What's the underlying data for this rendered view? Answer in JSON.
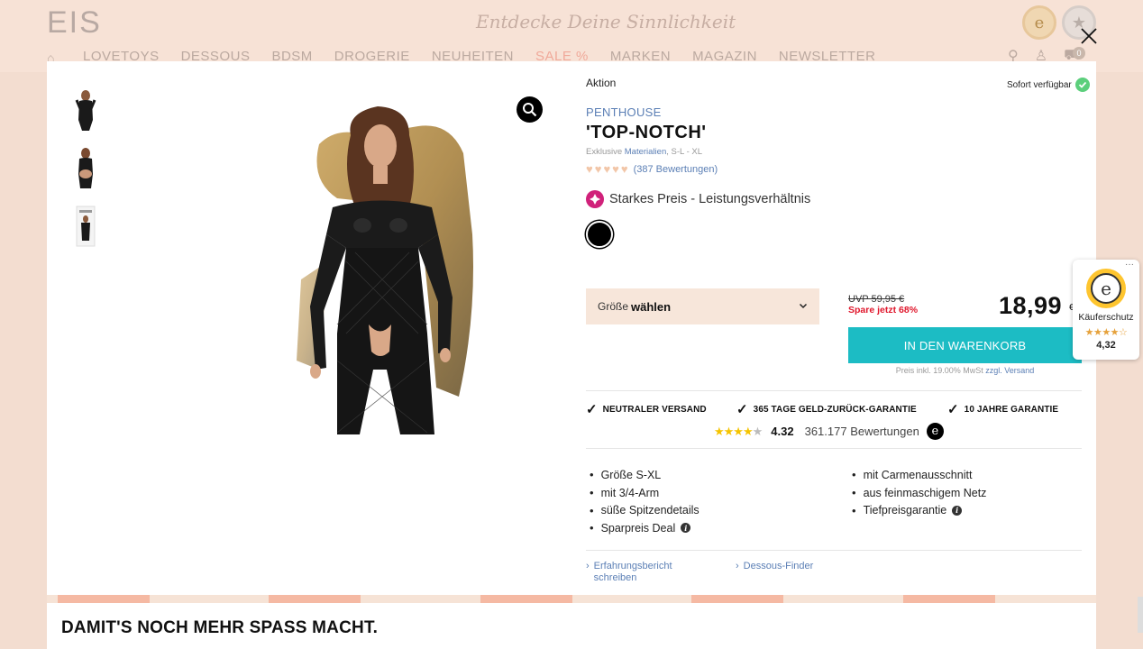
{
  "background": {
    "logo": "EIS",
    "slogan": "Entdecke Deine Sinnlichkeit",
    "nav": [
      "LOVETOYS",
      "DESSOUS",
      "BDSM",
      "DROGERIE",
      "NEUHEITEN",
      "SALE %",
      "MARKEN",
      "MAGAZIN",
      "NEWSLETTER"
    ],
    "cart_count": "0",
    "bottom_heading": "DAMIT'S NOCH MEHR SPASS MACHT."
  },
  "product": {
    "tag": "Aktion",
    "availability": "Sofort verfügbar",
    "brand": "PENTHOUSE",
    "title": "'TOP-NOTCH'",
    "subline_prefix": "Exklusive ",
    "subline_link": "Materialien",
    "subline_sizes": ", S-L - XL",
    "rating_hearts": 5,
    "rating_link": "(387 Bewertungen)",
    "value_badge": "Starkes Preis - Leistungsverhältnis",
    "color": "#000000"
  },
  "purchase": {
    "size_label": "Größe",
    "size_action": "wählen",
    "uvp": "UVP 59,95 €",
    "savings": "Spare jetzt 68%",
    "price": "18,99",
    "currency": "€",
    "cart_button": "IN DEN WARENKORB",
    "tax_note": "Preis inkl. 19.00% MwSt",
    "shipping_link": "zzgl. Versand"
  },
  "guarantees": [
    "NEUTRALER VERSAND",
    "365 TAGE GELD-ZURÜCK-GARANTIE",
    "10 JAHRE GARANTIE"
  ],
  "trusted_shops": {
    "score": "4.32",
    "reviews": "361.177 Bewertungen",
    "widget_label": "Käuferschutz",
    "widget_score": "4,32"
  },
  "features_left": [
    "Größe S-XL",
    "mit 3/4-Arm",
    "süße Spitzendetails",
    "Sparpreis Deal"
  ],
  "features_right": [
    "mit Carmenausschnitt",
    "aus feinmaschigem Netz",
    "Tiefpreisgarantie"
  ],
  "links": {
    "review": "Erfahrungsbericht schreiben",
    "finder": "Dessous-Finder"
  }
}
